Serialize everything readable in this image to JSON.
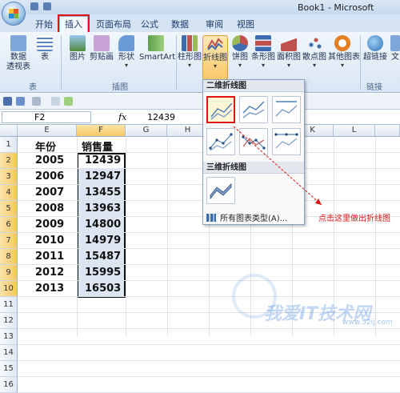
{
  "window": {
    "title": "Book1 - Microsoft"
  },
  "tabs": [
    "开始",
    "插入",
    "页面布局",
    "公式",
    "数据",
    "审阅",
    "视图"
  ],
  "ribbon": {
    "groups": {
      "table": "表",
      "illustrations": "插图",
      "links": "链接"
    },
    "buttons": {
      "pivot_line1": "数据",
      "pivot_line2": "透视表",
      "table": "表",
      "picture": "图片",
      "clipart": "剪贴画",
      "shapes": "形状",
      "smartart": "SmartArt",
      "column": "柱形图",
      "line": "折线图",
      "pie": "饼图",
      "bar": "条形图",
      "area": "面积图",
      "scatter": "散点图",
      "other": "其他图表",
      "hyperlink": "超链接",
      "text_partial": "文"
    }
  },
  "formula_bar": {
    "name_box": "F2",
    "fx": "fx",
    "value": "12439"
  },
  "columns": [
    "E",
    "F",
    "G",
    "H",
    "I",
    "J",
    "K",
    "L"
  ],
  "rows": [
    "1",
    "2",
    "3",
    "4",
    "5",
    "6",
    "7",
    "8",
    "9",
    "10",
    "11",
    "12",
    "13",
    "14",
    "15",
    "16"
  ],
  "sheet": {
    "header_year": "年份",
    "header_sales": "销售量",
    "data": [
      {
        "year": "2005",
        "sales": "12439"
      },
      {
        "year": "2006",
        "sales": "12947"
      },
      {
        "year": "2007",
        "sales": "13455"
      },
      {
        "year": "2008",
        "sales": "13963"
      },
      {
        "year": "2009",
        "sales": "14800"
      },
      {
        "year": "2010",
        "sales": "14979"
      },
      {
        "year": "2011",
        "sales": "15487"
      },
      {
        "year": "2012",
        "sales": "15995"
      },
      {
        "year": "2013",
        "sales": "16503"
      }
    ]
  },
  "dropdown": {
    "section_2d": "二维折线图",
    "section_3d": "三维折线图",
    "all_chart_types": "所有图表类型(A)..."
  },
  "annotation": "点击这里做出折线图",
  "watermark": {
    "text": "我爱IT技术网",
    "site": "www.52ij.com"
  },
  "colors": {
    "accent_red": "#e01414",
    "ribbon_blue": "#d5e3f5",
    "highlight": "#f9c86a"
  }
}
